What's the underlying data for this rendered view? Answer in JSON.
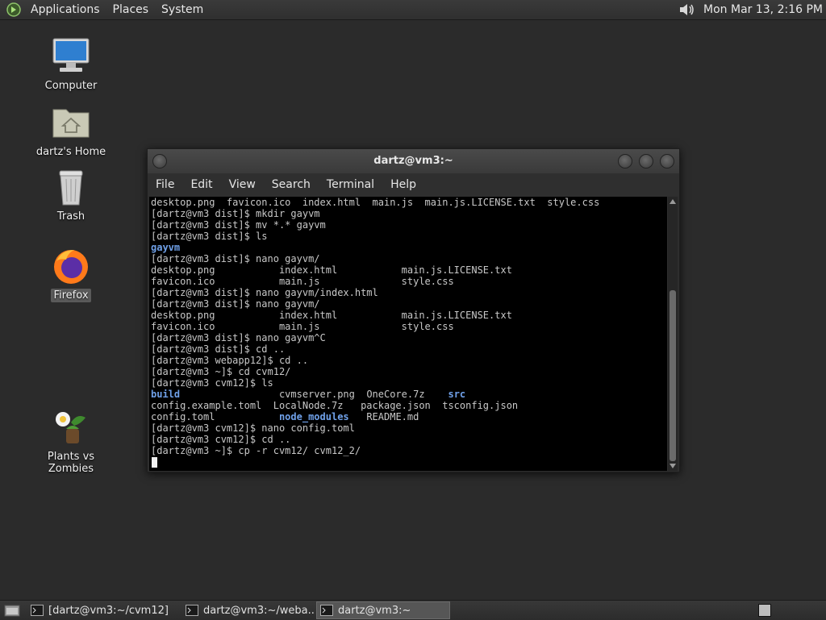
{
  "top_panel": {
    "menus": [
      "Applications",
      "Places",
      "System"
    ],
    "clock": "Mon Mar 13,  2:16 PM"
  },
  "desktop_icons": [
    {
      "label": "Computer"
    },
    {
      "label": "dartz's Home"
    },
    {
      "label": "Trash"
    },
    {
      "label": "Firefox"
    },
    {
      "label": "Plants vs Zombies"
    }
  ],
  "terminal": {
    "title": "dartz@vm3:~",
    "menu": [
      "File",
      "Edit",
      "View",
      "Search",
      "Terminal",
      "Help"
    ],
    "lines": [
      "desktop.png  favicon.ico  index.html  main.js  main.js.LICENSE.txt  style.css",
      "[dartz@vm3 dist]$ mkdir gayvm",
      "[dartz@vm3 dist]$ mv *.* gayvm",
      "[dartz@vm3 dist]$ ls",
      "gayvm",
      "[dartz@vm3 dist]$ nano gayvm/",
      "desktop.png           index.html           main.js.LICENSE.txt",
      "favicon.ico           main.js              style.css",
      "[dartz@vm3 dist]$ nano gayvm/index.html",
      "[dartz@vm3 dist]$ nano gayvm/",
      "desktop.png           index.html           main.js.LICENSE.txt",
      "favicon.ico           main.js              style.css",
      "[dartz@vm3 dist]$ nano gayvm^C",
      "[dartz@vm3 dist]$ cd ..",
      "[dartz@vm3 webapp12]$ cd ..",
      "[dartz@vm3 ~]$ cd cvm12/",
      "[dartz@vm3 cvm12]$ ls",
      "build                 cvmserver.png  OneCore.7z    src",
      "config.example.toml  LocalNode.7z   package.json  tsconfig.json",
      "config.toml           node_modules   README.md",
      "[dartz@vm3 cvm12]$ nano config.toml",
      "[dartz@vm3 cvm12]$ cd ..",
      "[dartz@vm3 ~]$ cp -r cvm12/ cvm12_2/",
      ""
    ],
    "dir_names": [
      "gayvm",
      "build",
      "src",
      "node_modules"
    ]
  },
  "taskbar": {
    "tasks": [
      {
        "label": "[dartz@vm3:~/cvm12]",
        "active": false
      },
      {
        "label": "dartz@vm3:~/weba...",
        "active": false
      },
      {
        "label": "dartz@vm3:~",
        "active": true
      }
    ]
  },
  "colors": {
    "desktop_bg": "#2b2b2b",
    "terminal_bg": "#000000",
    "terminal_fg": "#c8c8c8",
    "directory": "#6fa0e8"
  }
}
